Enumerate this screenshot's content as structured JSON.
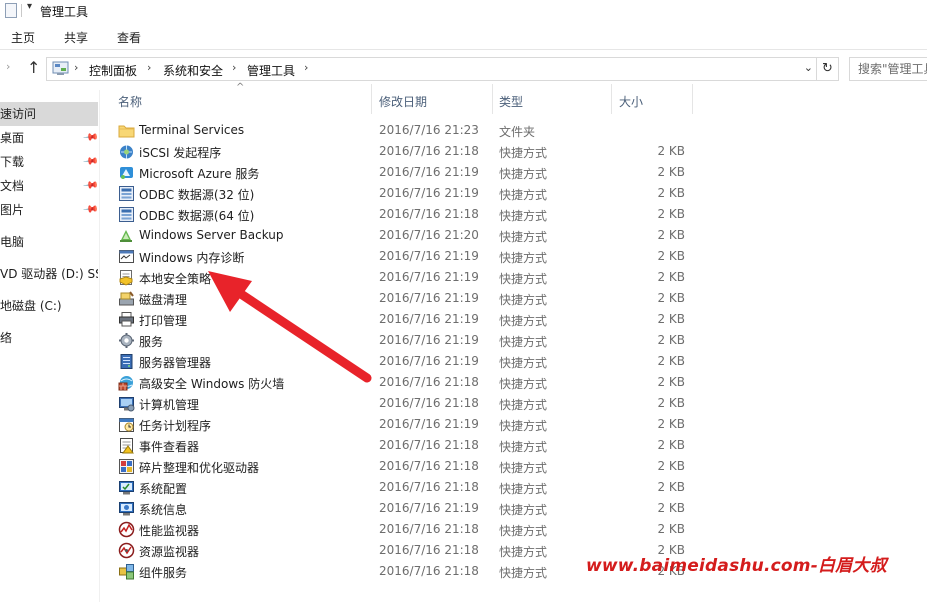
{
  "window": {
    "title": "管理工具"
  },
  "ribbon": {
    "tabs": [
      "主页",
      "共享",
      "查看"
    ]
  },
  "address": {
    "crumbs": [
      "控制面板",
      "系统和安全",
      "管理工具"
    ],
    "search_placeholder": "搜索\"管理工具\""
  },
  "nav": {
    "items": [
      {
        "label": "速访问",
        "selected": true,
        "pinned": false
      },
      {
        "label": "桌面",
        "selected": false,
        "pinned": true
      },
      {
        "label": "下载",
        "selected": false,
        "pinned": true
      },
      {
        "label": "文档",
        "selected": false,
        "pinned": true
      },
      {
        "label": "图片",
        "selected": false,
        "pinned": true
      },
      {
        "label": "电脑",
        "selected": false,
        "pinned": false
      },
      {
        "label": "VD 驱动器 (D:) SSS",
        "selected": false,
        "pinned": false
      },
      {
        "label": "地磁盘 (C:)",
        "selected": false,
        "pinned": false
      },
      {
        "label": "络",
        "selected": false,
        "pinned": false
      }
    ]
  },
  "columns": {
    "name": "名称",
    "date": "修改日期",
    "type": "类型",
    "size": "大小"
  },
  "files": [
    {
      "name": "Terminal Services",
      "date": "2016/7/16 21:23",
      "type": "文件夹",
      "size": "",
      "icon": "folder-icon"
    },
    {
      "name": "iSCSI 发起程序",
      "date": "2016/7/16 21:18",
      "type": "快捷方式",
      "size": "2 KB",
      "icon": "iscsi-icon"
    },
    {
      "name": "Microsoft Azure 服务",
      "date": "2016/7/16 21:19",
      "type": "快捷方式",
      "size": "2 KB",
      "icon": "azure-icon"
    },
    {
      "name": "ODBC 数据源(32 位)",
      "date": "2016/7/16 21:19",
      "type": "快捷方式",
      "size": "2 KB",
      "icon": "odbc-icon"
    },
    {
      "name": "ODBC 数据源(64 位)",
      "date": "2016/7/16 21:18",
      "type": "快捷方式",
      "size": "2 KB",
      "icon": "odbc-icon"
    },
    {
      "name": "Windows Server Backup",
      "date": "2016/7/16 21:20",
      "type": "快捷方式",
      "size": "2 KB",
      "icon": "backup-icon"
    },
    {
      "name": "Windows 内存诊断",
      "date": "2016/7/16 21:19",
      "type": "快捷方式",
      "size": "2 KB",
      "icon": "memory-icon"
    },
    {
      "name": "本地安全策略",
      "date": "2016/7/16 21:19",
      "type": "快捷方式",
      "size": "2 KB",
      "icon": "security-policy-icon"
    },
    {
      "name": "磁盘清理",
      "date": "2016/7/16 21:19",
      "type": "快捷方式",
      "size": "2 KB",
      "icon": "disk-cleanup-icon"
    },
    {
      "name": "打印管理",
      "date": "2016/7/16 21:19",
      "type": "快捷方式",
      "size": "2 KB",
      "icon": "printer-icon"
    },
    {
      "name": "服务",
      "date": "2016/7/16 21:19",
      "type": "快捷方式",
      "size": "2 KB",
      "icon": "services-icon"
    },
    {
      "name": "服务器管理器",
      "date": "2016/7/16 21:19",
      "type": "快捷方式",
      "size": "2 KB",
      "icon": "server-manager-icon"
    },
    {
      "name": "高级安全 Windows 防火墙",
      "date": "2016/7/16 21:18",
      "type": "快捷方式",
      "size": "2 KB",
      "icon": "firewall-icon"
    },
    {
      "name": "计算机管理",
      "date": "2016/7/16 21:18",
      "type": "快捷方式",
      "size": "2 KB",
      "icon": "computer-management-icon"
    },
    {
      "name": "任务计划程序",
      "date": "2016/7/16 21:19",
      "type": "快捷方式",
      "size": "2 KB",
      "icon": "task-scheduler-icon"
    },
    {
      "name": "事件查看器",
      "date": "2016/7/16 21:18",
      "type": "快捷方式",
      "size": "2 KB",
      "icon": "event-viewer-icon"
    },
    {
      "name": "碎片整理和优化驱动器",
      "date": "2016/7/16 21:18",
      "type": "快捷方式",
      "size": "2 KB",
      "icon": "defrag-icon"
    },
    {
      "name": "系统配置",
      "date": "2016/7/16 21:18",
      "type": "快捷方式",
      "size": "2 KB",
      "icon": "system-config-icon"
    },
    {
      "name": "系统信息",
      "date": "2016/7/16 21:19",
      "type": "快捷方式",
      "size": "2 KB",
      "icon": "system-info-icon"
    },
    {
      "name": "性能监视器",
      "date": "2016/7/16 21:18",
      "type": "快捷方式",
      "size": "2 KB",
      "icon": "performance-monitor-icon"
    },
    {
      "name": "资源监视器",
      "date": "2016/7/16 21:18",
      "type": "快捷方式",
      "size": "2 KB",
      "icon": "resource-monitor-icon"
    },
    {
      "name": "组件服务",
      "date": "2016/7/16 21:18",
      "type": "快捷方式",
      "size": "2 KB",
      "icon": "component-services-icon"
    }
  ],
  "watermark": "www.baimeidashu.com-白眉大叔",
  "colors": {
    "annotation_arrow": "#e8232a",
    "watermark": "#d41c1c",
    "selected_nav": "#d9d9d9"
  }
}
